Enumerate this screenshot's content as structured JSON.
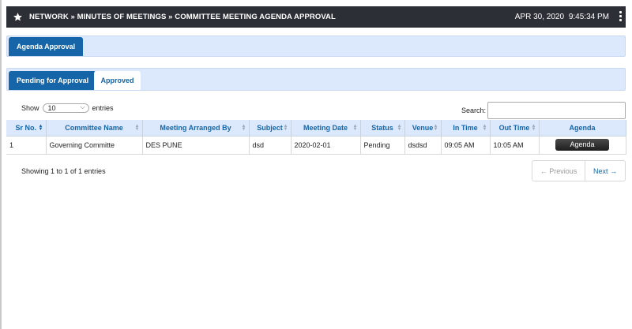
{
  "header": {
    "breadcrumb": "NETWORK » MINUTES OF MEETINGS » COMMITTEE MEETING AGENDA APPROVAL",
    "date": "APR 30, 2020",
    "time": "9:45:34 PM",
    "icon": "star-icon",
    "menu_icon": "kebab-menu-icon",
    "bar_color": "#2c2f36"
  },
  "main_tab": {
    "label": "Agenda Approval"
  },
  "sub_tabs": [
    {
      "label": "Pending for Approval",
      "active": true
    },
    {
      "label": "Approved",
      "active": false
    }
  ],
  "length_control": {
    "prefix": "Show",
    "value": "10",
    "suffix": "entries"
  },
  "search": {
    "label": "Search:",
    "value": ""
  },
  "table": {
    "columns": [
      "Sr No.",
      "Committee Name",
      "Meeting Arranged By",
      "Subject",
      "Meeting Date",
      "Status",
      "Venue",
      "In Time",
      "Out Time",
      "Agenda"
    ],
    "rows": [
      {
        "sr_no": "1",
        "committee_name": "Governing Committe",
        "arranged_by": "DES PUNE",
        "subject": "dsd",
        "meeting_date": "2020-02-01",
        "status": "Pending",
        "venue": "dsdsd",
        "in_time": "09:05 AM",
        "out_time": "10:05 AM",
        "agenda_button": "Agenda"
      }
    ]
  },
  "footer": {
    "info": "Showing 1 to 1 of 1 entries",
    "prev_label": "← Previous",
    "next_label": "Next →"
  },
  "colors": {
    "accent": "#1565a8",
    "band": "#dce8fb"
  }
}
